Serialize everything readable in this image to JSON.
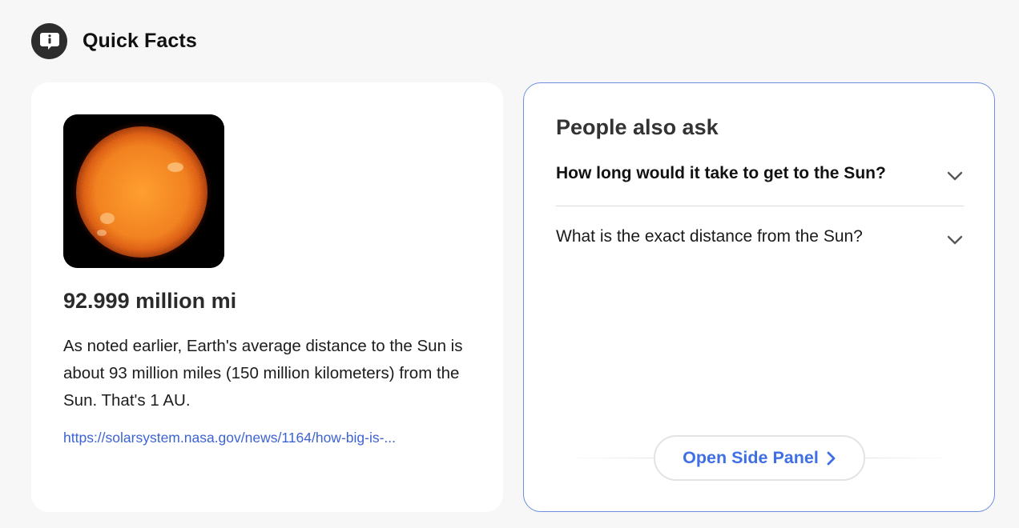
{
  "header": {
    "title": "Quick Facts",
    "icon": "info-bubble-icon"
  },
  "fact": {
    "image": "sun-image",
    "value": "92.999 million mi",
    "description": "As noted earlier, Earth's average distance to the Sun is about 93 million miles (150 million kilometers) from the Sun. That's 1 AU.",
    "link_text": "https://solarsystem.nasa.gov/news/1164/how-big-is-..."
  },
  "people_also_ask": {
    "title": "People also ask",
    "questions": [
      {
        "text": "How long would it take to get to the Sun?",
        "icon": "chevron-down-icon"
      },
      {
        "text": "What is the exact distance from the Sun?",
        "icon": "chevron-down-icon"
      }
    ],
    "open_side_panel_label": "Open Side Panel",
    "open_side_panel_icon": "chevron-right-icon"
  },
  "colors": {
    "accent": "#3f6fe4",
    "link": "#3d63d2",
    "card_border": "#6e8fe0",
    "background": "#f7f7f7"
  }
}
